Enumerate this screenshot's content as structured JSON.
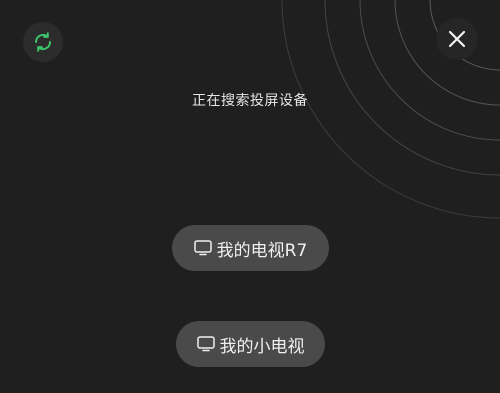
{
  "status": {
    "text": "正在搜索投屏设备"
  },
  "devices": [
    {
      "label": "我的电视R7"
    },
    {
      "label": "我的小电视"
    }
  ],
  "colors": {
    "background": "#1f1f1f",
    "pill": "#4a4a4a",
    "accent": "#3cc46a",
    "text": "#f0f0f0"
  },
  "icons": {
    "refresh": "refresh-icon",
    "close": "close-icon",
    "tv": "tv-icon"
  }
}
